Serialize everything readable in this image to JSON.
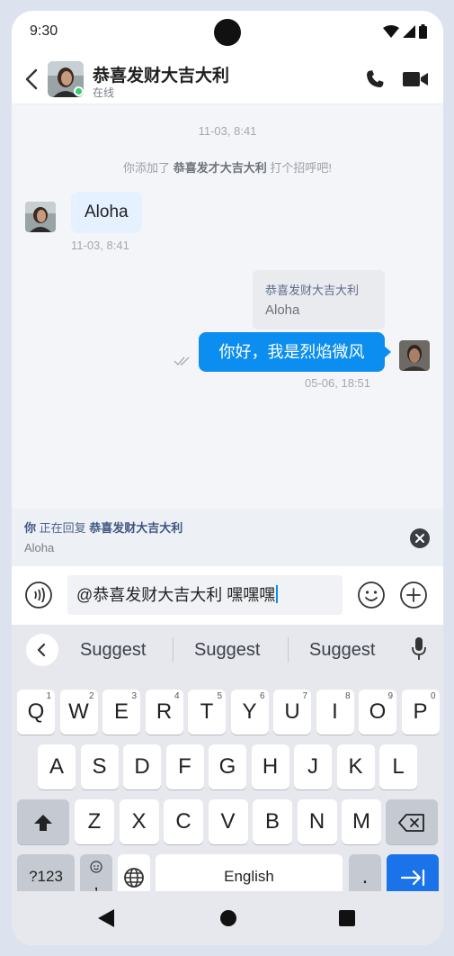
{
  "status_bar": {
    "time": "9:30"
  },
  "header": {
    "contact_name": "恭喜发财大吉大利",
    "presence": "在线"
  },
  "chat": {
    "time_separator": "11-03, 8:41",
    "system_note": {
      "prefix": "你添加了",
      "name": "恭喜发才大吉大利",
      "suffix": "打个招呼吧!"
    },
    "incoming": {
      "text": "Aloha",
      "timestamp": "11-03, 8:41"
    },
    "outgoing": {
      "quote_name": "恭喜发财大吉大利",
      "quote_text": "Aloha",
      "text": "你好，我是烈焰微风",
      "timestamp": "05-06, 18:51"
    }
  },
  "reply_bar": {
    "you": "你",
    "action": "正在回复",
    "name": "恭喜发财大吉大利",
    "quoted": "Aloha"
  },
  "composer": {
    "value": "@恭喜发财大吉大利 嘿嘿嘿"
  },
  "keyboard": {
    "suggestions": [
      "Suggest",
      "Suggest",
      "Suggest"
    ],
    "row1": [
      {
        "k": "Q",
        "h": "1"
      },
      {
        "k": "W",
        "h": "2"
      },
      {
        "k": "E",
        "h": "3"
      },
      {
        "k": "R",
        "h": "4"
      },
      {
        "k": "T",
        "h": "5"
      },
      {
        "k": "Y",
        "h": "6"
      },
      {
        "k": "U",
        "h": "7"
      },
      {
        "k": "I",
        "h": "8"
      },
      {
        "k": "O",
        "h": "9"
      },
      {
        "k": "P",
        "h": "0"
      }
    ],
    "row2": [
      "A",
      "S",
      "D",
      "F",
      "G",
      "H",
      "J",
      "K",
      "L"
    ],
    "row3": [
      "Z",
      "X",
      "C",
      "V",
      "B",
      "N",
      "M"
    ],
    "symbols_label": "?123",
    "comma": ",",
    "space_label": "English",
    "period": "."
  },
  "colors": {
    "accent": "#0c8ef0",
    "online": "#2fd16e",
    "enter_key": "#1a73e8"
  },
  "icons": [
    "back-arrow-icon",
    "phone-icon",
    "video-camera-icon",
    "read-check-icon",
    "close-icon",
    "voice-icon",
    "emoji-icon",
    "plus-icon",
    "mic-icon",
    "shift-icon",
    "backspace-icon",
    "globe-icon",
    "enter-icon"
  ]
}
